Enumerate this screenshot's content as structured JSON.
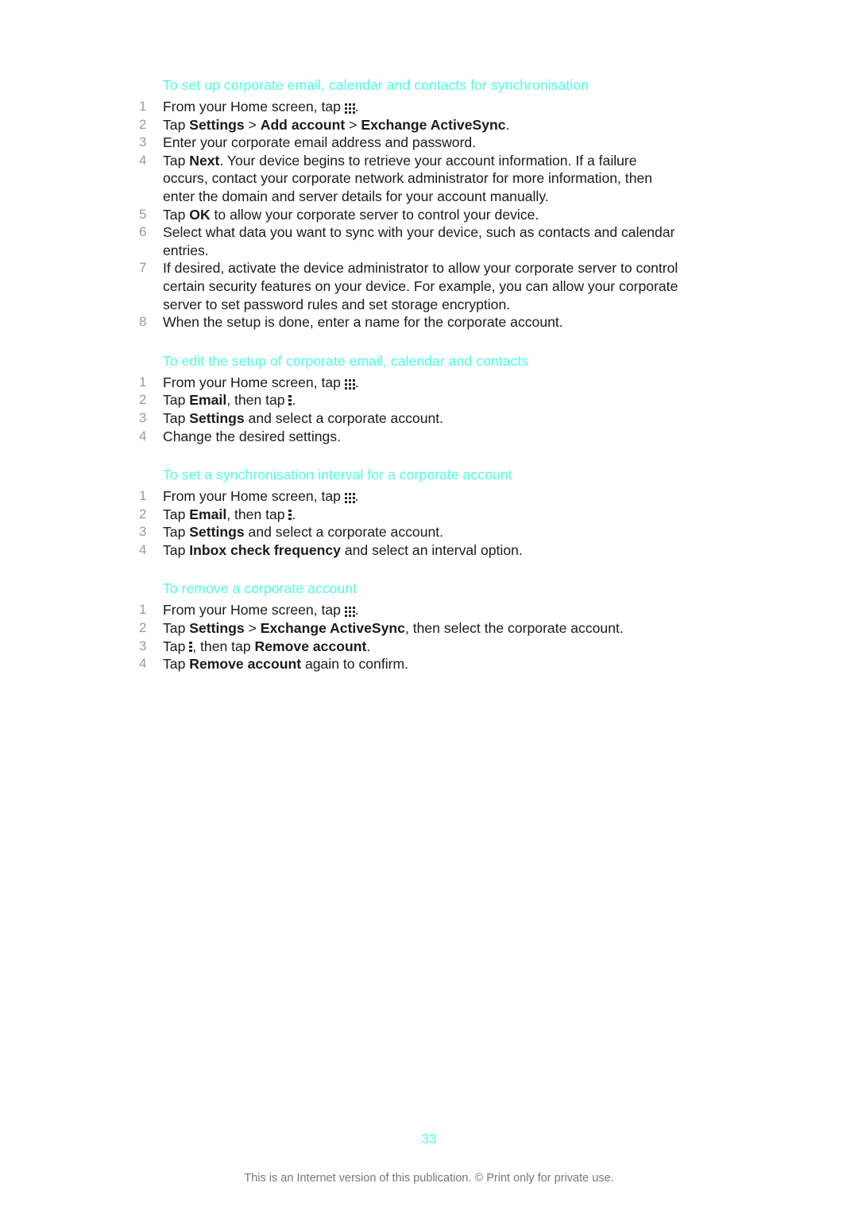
{
  "document": {
    "page_number": "33",
    "footer_note": "This is an Internet version of this publication. © Print only for private use.",
    "heading_color": "#4DFFE3",
    "body_color": "#1b1b1b",
    "number_color": "#9b9b9b",
    "footer_color": "#777777"
  },
  "sections": [
    {
      "heading": "To set up corporate email, calendar and contacts for synchronisation",
      "steps": [
        {
          "parts": [
            {
              "type": "text",
              "text": "From your Home screen, tap "
            },
            {
              "type": "icon",
              "icon": "app-drawer-grid-icon"
            },
            {
              "type": "text",
              "text": "."
            }
          ]
        },
        {
          "parts": [
            {
              "type": "text",
              "text": "Tap "
            },
            {
              "type": "bold",
              "text": "Settings"
            },
            {
              "type": "text",
              "text": " > "
            },
            {
              "type": "bold",
              "text": "Add account"
            },
            {
              "type": "text",
              "text": " > "
            },
            {
              "type": "bold",
              "text": "Exchange ActiveSync"
            },
            {
              "type": "text",
              "text": "."
            }
          ]
        },
        {
          "parts": [
            {
              "type": "text",
              "text": "Enter your corporate email address and password."
            }
          ]
        },
        {
          "parts": [
            {
              "type": "text",
              "text": "Tap "
            },
            {
              "type": "bold",
              "text": "Next"
            },
            {
              "type": "text",
              "text": ". Your device begins to retrieve your account information. If a failure occurs, contact your corporate network administrator for more information, then enter the domain and server details for your account manually."
            }
          ]
        },
        {
          "parts": [
            {
              "type": "text",
              "text": "Tap "
            },
            {
              "type": "bold",
              "text": "OK"
            },
            {
              "type": "text",
              "text": " to allow your corporate server to control your device."
            }
          ]
        },
        {
          "parts": [
            {
              "type": "text",
              "text": "Select what data you want to sync with your device, such as contacts and calendar entries."
            }
          ]
        },
        {
          "parts": [
            {
              "type": "text",
              "text": "If desired, activate the device administrator to allow your corporate server to control certain security features on your device. For example, you can allow your corporate server to set password rules and set storage encryption."
            }
          ]
        },
        {
          "parts": [
            {
              "type": "text",
              "text": "When the setup is done, enter a name for the corporate account."
            }
          ]
        }
      ]
    },
    {
      "heading": "To edit the setup of corporate email, calendar and contacts",
      "steps": [
        {
          "parts": [
            {
              "type": "text",
              "text": "From your Home screen, tap "
            },
            {
              "type": "icon",
              "icon": "app-drawer-grid-icon"
            },
            {
              "type": "text",
              "text": "."
            }
          ]
        },
        {
          "parts": [
            {
              "type": "text",
              "text": "Tap "
            },
            {
              "type": "bold",
              "text": "Email"
            },
            {
              "type": "text",
              "text": ", then tap "
            },
            {
              "type": "icon",
              "icon": "overflow-menu-icon"
            },
            {
              "type": "text",
              "text": "."
            }
          ]
        },
        {
          "parts": [
            {
              "type": "text",
              "text": "Tap "
            },
            {
              "type": "bold",
              "text": "Settings"
            },
            {
              "type": "text",
              "text": " and select a corporate account."
            }
          ]
        },
        {
          "parts": [
            {
              "type": "text",
              "text": "Change the desired settings."
            }
          ]
        }
      ]
    },
    {
      "heading": "To set a synchronisation interval for a corporate account",
      "steps": [
        {
          "parts": [
            {
              "type": "text",
              "text": "From your Home screen, tap "
            },
            {
              "type": "icon",
              "icon": "app-drawer-grid-icon"
            },
            {
              "type": "text",
              "text": "."
            }
          ]
        },
        {
          "parts": [
            {
              "type": "text",
              "text": "Tap "
            },
            {
              "type": "bold",
              "text": "Email"
            },
            {
              "type": "text",
              "text": ", then tap "
            },
            {
              "type": "icon",
              "icon": "overflow-menu-icon"
            },
            {
              "type": "text",
              "text": "."
            }
          ]
        },
        {
          "parts": [
            {
              "type": "text",
              "text": "Tap "
            },
            {
              "type": "bold",
              "text": "Settings"
            },
            {
              "type": "text",
              "text": " and select a corporate account."
            }
          ]
        },
        {
          "parts": [
            {
              "type": "text",
              "text": "Tap "
            },
            {
              "type": "bold",
              "text": "Inbox check frequency"
            },
            {
              "type": "text",
              "text": " and select an interval option."
            }
          ]
        }
      ]
    },
    {
      "heading": "To remove a corporate account",
      "steps": [
        {
          "parts": [
            {
              "type": "text",
              "text": "From your Home screen, tap "
            },
            {
              "type": "icon",
              "icon": "app-drawer-grid-icon"
            },
            {
              "type": "text",
              "text": "."
            }
          ]
        },
        {
          "parts": [
            {
              "type": "text",
              "text": "Tap "
            },
            {
              "type": "bold",
              "text": "Settings"
            },
            {
              "type": "text",
              "text": " > "
            },
            {
              "type": "bold",
              "text": "Exchange ActiveSync"
            },
            {
              "type": "text",
              "text": ", then select the corporate account."
            }
          ]
        },
        {
          "parts": [
            {
              "type": "text",
              "text": "Tap "
            },
            {
              "type": "icon",
              "icon": "overflow-menu-icon"
            },
            {
              "type": "text",
              "text": ", then tap "
            },
            {
              "type": "bold",
              "text": "Remove account"
            },
            {
              "type": "text",
              "text": "."
            }
          ]
        },
        {
          "parts": [
            {
              "type": "text",
              "text": "Tap "
            },
            {
              "type": "bold",
              "text": "Remove account"
            },
            {
              "type": "text",
              "text": " again to confirm."
            }
          ]
        }
      ]
    }
  ]
}
